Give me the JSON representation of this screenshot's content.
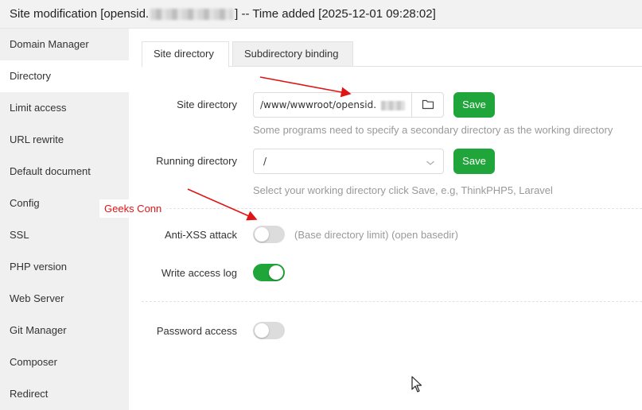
{
  "window": {
    "title_prefix": "Site modification [opensid.",
    "title_suffix": "] -- Time added [2025-12-01 09:28:02]"
  },
  "sidebar": {
    "items": [
      {
        "label": "Domain Manager"
      },
      {
        "label": "Directory"
      },
      {
        "label": "Limit access"
      },
      {
        "label": "URL rewrite"
      },
      {
        "label": "Default document"
      },
      {
        "label": "Config"
      },
      {
        "label": "SSL"
      },
      {
        "label": "PHP version"
      },
      {
        "label": "Web Server"
      },
      {
        "label": "Git Manager"
      },
      {
        "label": "Composer"
      },
      {
        "label": "Redirect"
      }
    ],
    "active": "Directory"
  },
  "tabs": [
    {
      "label": "Site directory",
      "active": true
    },
    {
      "label": "Subdirectory binding",
      "active": false
    }
  ],
  "site_directory": {
    "label": "Site directory",
    "value": "/www/wwwroot/opensid.",
    "folder_icon": "folder-icon",
    "save_label": "Save",
    "hint": "Some programs need to specify a secondary directory as the working directory"
  },
  "running_directory": {
    "label": "Running directory",
    "selected": "/",
    "dropdown_icon": "chevron-down-icon",
    "save_label": "Save",
    "hint": "Select your working directory click Save, e.g, ThinkPHP5, Laravel"
  },
  "anti_xss": {
    "label": "Anti-XSS attack",
    "enabled": false,
    "description": "(Base directory limit) (open basedir)"
  },
  "write_access_log": {
    "label": "Write access log",
    "enabled": true
  },
  "password_access": {
    "label": "Password access",
    "enabled": false
  },
  "annotation": {
    "text": "Geeks Conn",
    "color": "#e01414"
  },
  "colors": {
    "accent": "#20a53a",
    "sidebar_bg": "#f0f0f0",
    "hint_text": "#999999"
  }
}
